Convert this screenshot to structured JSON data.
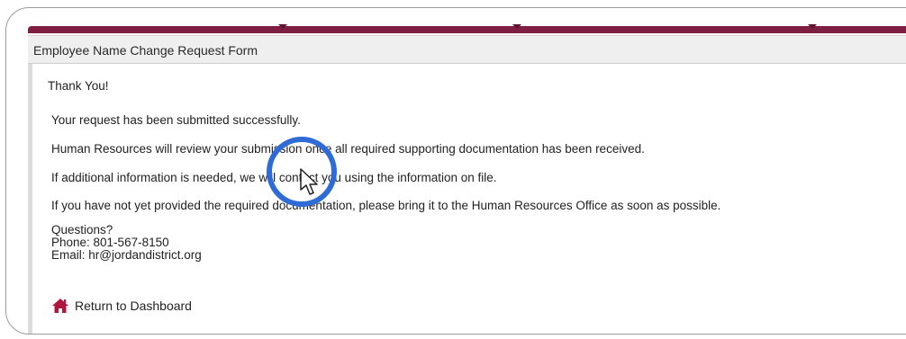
{
  "panel": {
    "title": "Employee Name Change Request Form"
  },
  "confirmation": {
    "heading": "Thank You!",
    "messages": [
      "Your request has been submitted successfully.",
      "Human Resources will review your submission once all required supporting documentation has been received.",
      "If additional information is needed, we will contact you using the information on file.",
      "If you have not yet provided the required documentation, please bring it to the Human Resources Office as soon as possible."
    ],
    "contact": {
      "questions_label": "Questions?",
      "phone": "Phone: 801-567-8150",
      "email": "Email: hr@jordandistrict.org"
    }
  },
  "actions": {
    "return_label": "Return to Dashboard",
    "return_icon": "home-icon"
  },
  "colors": {
    "brand_bar": "#7e1e41",
    "home_icon": "#b0173f",
    "cursor_highlight": "#2f6bd6"
  }
}
